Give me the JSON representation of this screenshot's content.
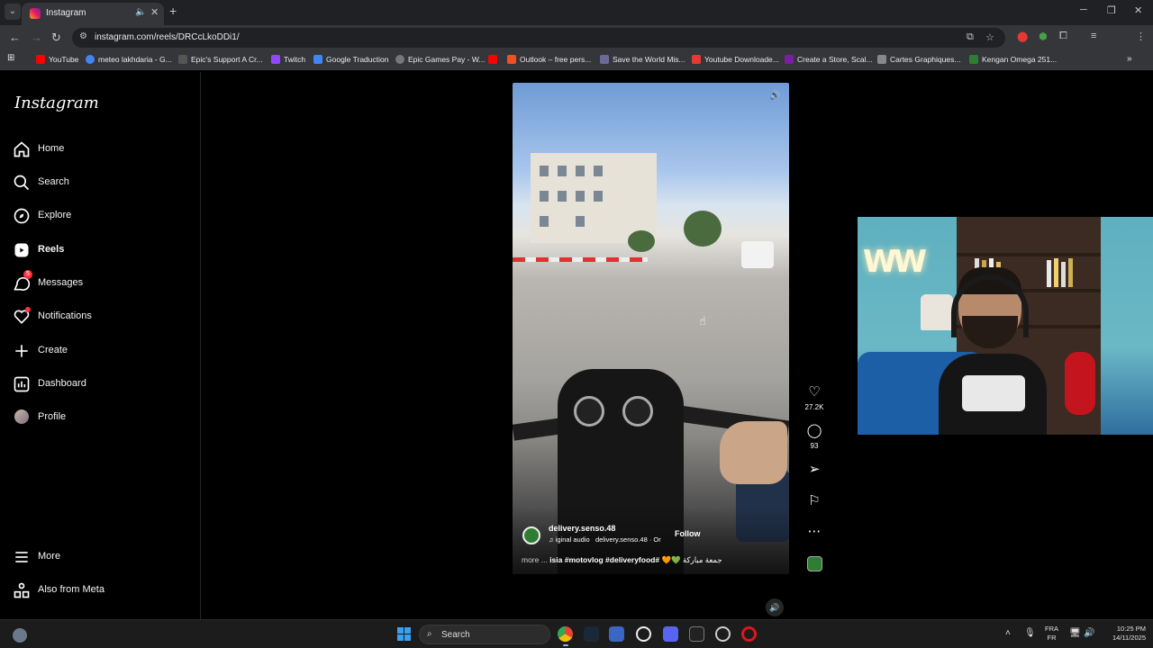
{
  "browser": {
    "tab": {
      "title": "Instagram",
      "audio_icon": "speaker-icon",
      "close_icon": "close-icon"
    },
    "new_tab_icon": "plus-icon",
    "window_controls": [
      "minimize-icon",
      "maximize-icon",
      "close-icon"
    ],
    "url": "instagram.com/reels/DRCcLkoDDi1/",
    "bookmarks": [
      {
        "label": "YouTube",
        "color": "#ff0000"
      },
      {
        "label": "meteo lakhdaria - G...",
        "color": "#4285f4"
      },
      {
        "label": "Epic's Support A Cr...",
        "color": "#555555"
      },
      {
        "label": "Twitch",
        "color": "#9146ff"
      },
      {
        "label": "Google Traduction",
        "color": "#4285f4"
      },
      {
        "label": "Epic Games Pay - W...",
        "color": "#777777"
      },
      {
        "label": "",
        "color": "#ff0000"
      },
      {
        "label": "Outlook – free pers...",
        "color": "#f25022"
      },
      {
        "label": "Save the World Mis...",
        "color": "#6a6a9a"
      },
      {
        "label": "Youtube Downloade...",
        "color": "#e53935"
      },
      {
        "label": "Create a Store, Scal...",
        "color": "#7b1fa2"
      },
      {
        "label": "Cartes Graphiques...",
        "color": "#888888"
      },
      {
        "label": "Kengan Omega 251...",
        "color": "#2e7d32"
      }
    ]
  },
  "instagram": {
    "logo": "Instagram",
    "nav": [
      {
        "label": "Home",
        "icon": "home-icon"
      },
      {
        "label": "Search",
        "icon": "search-icon"
      },
      {
        "label": "Explore",
        "icon": "compass-icon"
      },
      {
        "label": "Reels",
        "icon": "reels-icon",
        "active": true
      },
      {
        "label": "Messages",
        "icon": "messenger-icon",
        "badge": "5"
      },
      {
        "label": "Notifications",
        "icon": "heart-icon"
      },
      {
        "label": "Create",
        "icon": "plus-icon"
      },
      {
        "label": "Dashboard",
        "icon": "chart-icon"
      },
      {
        "label": "Profile",
        "icon": "avatar"
      }
    ],
    "bottom_nav": [
      {
        "label": "More",
        "icon": "menu-icon"
      },
      {
        "label": "Also from Meta",
        "icon": "meta-apps-icon"
      }
    ],
    "reel": {
      "author": "delivery.senso.48",
      "audio": "iginal audio",
      "audio_author": "delivery.senso.48 · Or",
      "follow_label": "Follow",
      "caption_more": "more ...",
      "caption_tags": "isia #motovlog #deliveryfood#",
      "caption_arabic": "جمعة مباركة",
      "likes": "27.2K",
      "comments": "93"
    }
  },
  "taskbar": {
    "search_label": "Search",
    "lang_top": "FRA",
    "lang_bottom": "FR",
    "time": "10:25 PM",
    "date": "14/11/2025"
  }
}
